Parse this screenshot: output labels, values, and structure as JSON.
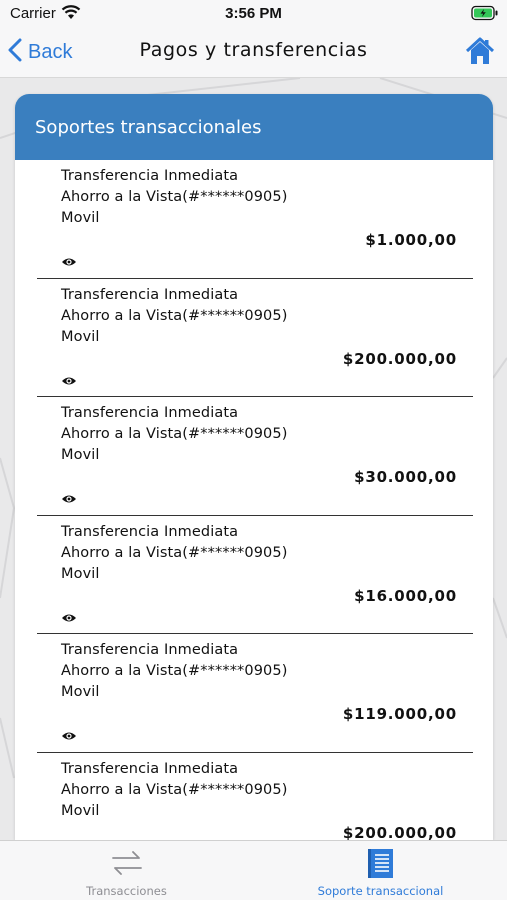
{
  "status_bar": {
    "carrier": "Carrier",
    "time": "3:56 PM"
  },
  "nav": {
    "back_label": "Back",
    "title": "Pagos y transferencias",
    "home_icon": "home-icon"
  },
  "card": {
    "title": "Soportes transaccionales"
  },
  "transactions": [
    {
      "type": "Transferencia Inmediata",
      "account": "Ahorro a la Vista(#******0905)",
      "channel": "Movil",
      "amount": "$1.000,00"
    },
    {
      "type": "Transferencia Inmediata",
      "account": "Ahorro a la Vista(#******0905)",
      "channel": "Movil",
      "amount": "$200.000,00"
    },
    {
      "type": "Transferencia Inmediata",
      "account": "Ahorro a la Vista(#******0905)",
      "channel": "Movil",
      "amount": "$30.000,00"
    },
    {
      "type": "Transferencia Inmediata",
      "account": "Ahorro a la Vista(#******0905)",
      "channel": "Movil",
      "amount": "$16.000,00"
    },
    {
      "type": "Transferencia Inmediata",
      "account": "Ahorro a la Vista(#******0905)",
      "channel": "Movil",
      "amount": "$119.000,00"
    },
    {
      "type": "Transferencia Inmediata",
      "account": "Ahorro a la Vista(#******0905)",
      "channel": "Movil",
      "amount": "$200.000,00"
    }
  ],
  "tabs": [
    {
      "label": "Transacciones",
      "icon": "transfer-arrows-icon",
      "active": false
    },
    {
      "label": "Soporte transaccional",
      "icon": "document-icon",
      "active": true
    }
  ],
  "colors": {
    "accent": "#2f7bd8",
    "header": "#3a7fbf",
    "battery": "#34c759"
  }
}
